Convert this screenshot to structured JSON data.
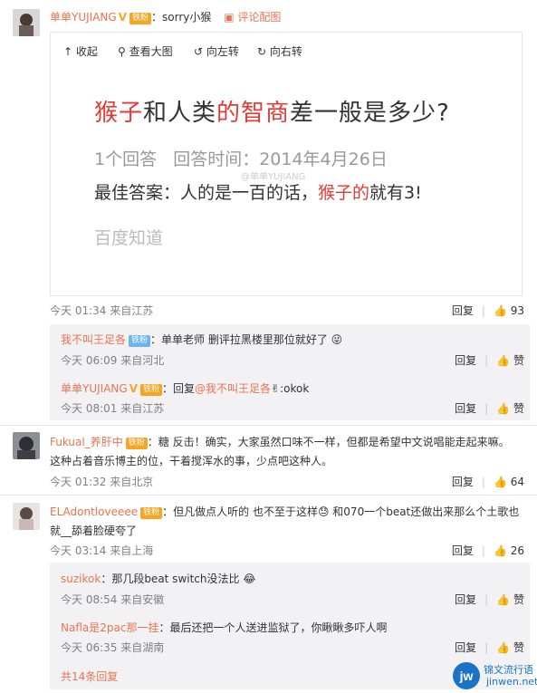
{
  "post": {
    "user": "单单YUJIANG",
    "badge": "铁粉",
    "text": "：sorry小猴",
    "review_link": "评论配图",
    "time": "今天 01:34 来自江苏",
    "reply": "回复",
    "likes": "93"
  },
  "image_toolbar": {
    "collapse": "收起",
    "view_large": "查看大图",
    "rotate_left": "向左转",
    "rotate_right": "向右转"
  },
  "screenshot": {
    "title_red1": "猴子",
    "title_mid": "和人类",
    "title_red2": "的智商",
    "title_end": "差一般是多少?",
    "meta": "1个回答   回答时间：2014年4月26日",
    "answer_prefix": "最佳答案：人的是一百的话，",
    "answer_red": "猴子的",
    "answer_end": "就有3!",
    "brand": "百度知道",
    "watermark": "@单单YUJIANG"
  },
  "replies1": [
    {
      "user": "我不叫王足各",
      "badge": "铁粉",
      "text": "：单单老师 删评拉黑楼里那位就好了",
      "time": "今天 06:09 来自河北",
      "reply": "回复",
      "like": "赞"
    },
    {
      "user": "单单YUJIANG",
      "badge": "铁粉",
      "text_prefix": "：回复",
      "mention": "@我不叫王足各",
      "text_end": ":okok",
      "time": "今天 08:01 来自江苏",
      "reply": "回复",
      "like": "赞"
    }
  ],
  "comment2": {
    "user": "Fukual_养肝中",
    "badge": "铁粉",
    "line1": "：糖 反击！确实，大家虽然口味不一样，但都是希望中文说唱能走起来嘛。",
    "line2": "这种占着音乐博主的位，干着搅浑水的事，少点吧这种人。",
    "time": "今天 01:32 来自北京",
    "reply": "回复",
    "likes": "64"
  },
  "comment3": {
    "user": "ELAdontloveeee",
    "badge": "铁粉",
    "line1": "：但凡做点人听的 也不至于这样",
    "line1b": " 和070一个beat还做出来那么个土歌也",
    "line2": "就__舔着脸硬夸了",
    "time": "今天 03:14 来自上海",
    "reply": "回复",
    "likes": "26"
  },
  "replies3": [
    {
      "user": "suzikok",
      "text": "：那几段beat switch没法比",
      "time": "今天 08:54 来自安徽",
      "reply": "回复",
      "like": "赞"
    },
    {
      "user": "Nafla是2pac那一挂",
      "text": "：最后还把一个人送进监狱了，你瞅瞅多吓人啊",
      "time": "今天 06:35 来自湖南",
      "reply": "回复",
      "like": "赞"
    }
  ],
  "more_replies": "共14条回复",
  "site_logo": {
    "mark": "jw",
    "line1": "锦文流行语",
    "line2": "jinwen.net"
  },
  "colors": {
    "name": "#eb7350",
    "red_text": "#e53935",
    "subbox": "#f2f2f5",
    "badge_gold": "#f5a623",
    "badge_blue": "#6db3f2"
  }
}
